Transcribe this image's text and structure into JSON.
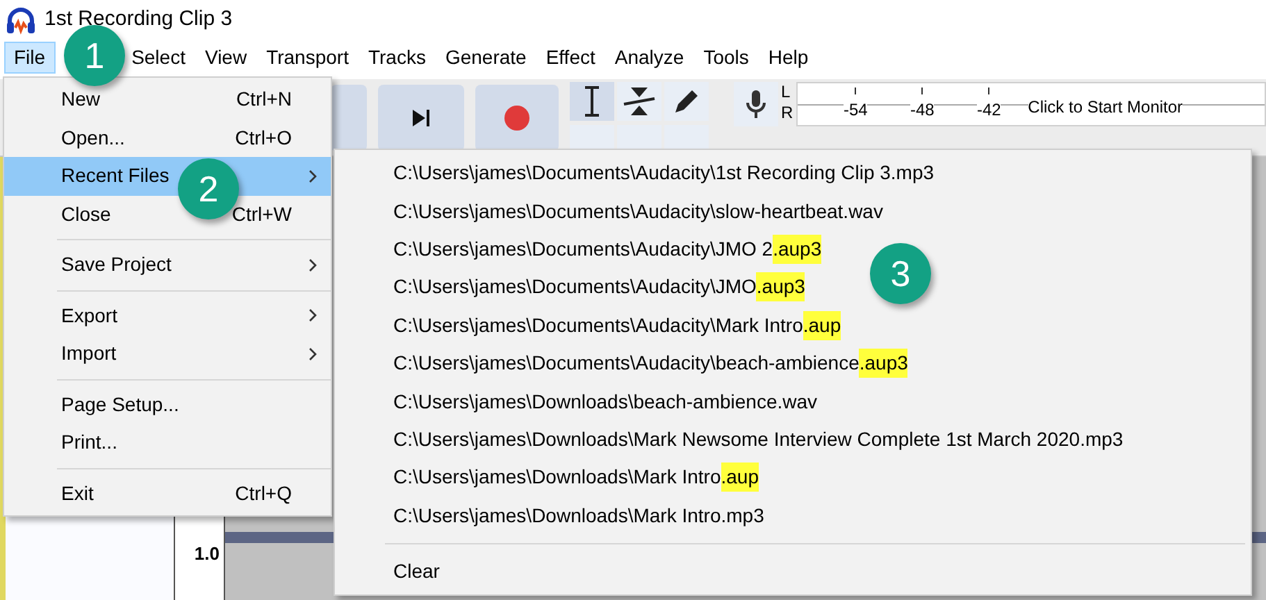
{
  "window": {
    "title": "1st Recording Clip 3"
  },
  "menu_bar": [
    {
      "label": "File",
      "selected": true
    },
    {
      "label": "Select",
      "selected": false
    },
    {
      "label": "View",
      "selected": false
    },
    {
      "label": "Transport",
      "selected": false
    },
    {
      "label": "Tracks",
      "selected": false
    },
    {
      "label": "Generate",
      "selected": false
    },
    {
      "label": "Effect",
      "selected": false
    },
    {
      "label": "Analyze",
      "selected": false
    },
    {
      "label": "Tools",
      "selected": false
    },
    {
      "label": "Help",
      "selected": false
    }
  ],
  "meter": {
    "channels": [
      "L",
      "R"
    ],
    "ticks": [
      "-54",
      "-48",
      "-42"
    ],
    "hint": "Click to Start Monitor"
  },
  "track": {
    "scale_label": "1.0"
  },
  "file_menu": [
    {
      "kind": "item",
      "label": "New",
      "shortcut": "Ctrl+N",
      "submenu": false,
      "selected": false
    },
    {
      "kind": "item",
      "label": "Open...",
      "shortcut": "Ctrl+O",
      "submenu": false,
      "selected": false
    },
    {
      "kind": "item",
      "label": "Recent Files",
      "submenu": true,
      "selected": true
    },
    {
      "kind": "item",
      "label": "Close",
      "shortcut": "Ctrl+W",
      "submenu": false,
      "selected": false
    },
    {
      "kind": "separator"
    },
    {
      "kind": "item",
      "label": "Save Project",
      "submenu": true,
      "selected": false
    },
    {
      "kind": "separator"
    },
    {
      "kind": "item",
      "label": "Export",
      "submenu": true,
      "selected": false
    },
    {
      "kind": "item",
      "label": "Import",
      "submenu": true,
      "selected": false
    },
    {
      "kind": "separator"
    },
    {
      "kind": "item",
      "label": "Page Setup...",
      "submenu": false,
      "selected": false
    },
    {
      "kind": "item",
      "label": "Print...",
      "submenu": false,
      "selected": false
    },
    {
      "kind": "separator"
    },
    {
      "kind": "item",
      "label": "Exit",
      "shortcut": "Ctrl+Q",
      "submenu": false,
      "selected": false
    }
  ],
  "recent_files": [
    {
      "kind": "item",
      "path": "C:\\Users\\james\\Documents\\Audacity\\1st Recording Clip 3.mp3"
    },
    {
      "kind": "item",
      "path": "C:\\Users\\james\\Documents\\Audacity\\slow-heartbeat.wav"
    },
    {
      "kind": "item",
      "path": "C:\\Users\\james\\Documents\\Audacity\\JMO 2",
      "highlight": ".aup3"
    },
    {
      "kind": "item",
      "path": "C:\\Users\\james\\Documents\\Audacity\\JMO",
      "highlight": ".aup3"
    },
    {
      "kind": "item",
      "path": "C:\\Users\\james\\Documents\\Audacity\\Mark Intro",
      "highlight": ".aup"
    },
    {
      "kind": "item",
      "path": "C:\\Users\\james\\Documents\\Audacity\\beach-ambience",
      "highlight": ".aup3"
    },
    {
      "kind": "item",
      "path": "C:\\Users\\james\\Downloads\\beach-ambience.wav"
    },
    {
      "kind": "item",
      "path": "C:\\Users\\james\\Downloads\\Mark Newsome Interview Complete 1st March 2020.mp3"
    },
    {
      "kind": "item",
      "path": "C:\\Users\\james\\Downloads\\Mark Intro",
      "highlight": ".aup"
    },
    {
      "kind": "item",
      "path": "C:\\Users\\james\\Downloads\\Mark Intro.mp3"
    },
    {
      "kind": "separator"
    },
    {
      "kind": "item",
      "path": "Clear"
    }
  ],
  "callouts": [
    {
      "number": "1"
    },
    {
      "number": "2"
    },
    {
      "number": "3"
    }
  ]
}
